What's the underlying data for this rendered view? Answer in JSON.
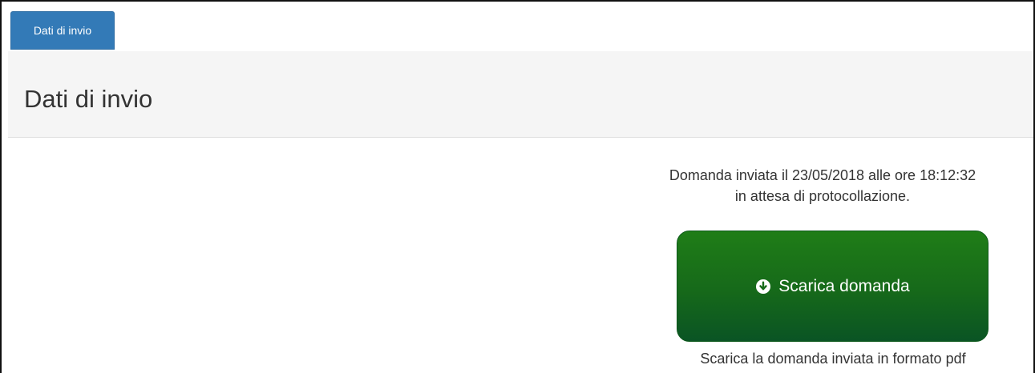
{
  "tabs": {
    "active_label": "Dati di invio"
  },
  "panel": {
    "title": "Dati di invio",
    "status": {
      "line1": "Domanda inviata il 23/05/2018 alle ore 18:12:32",
      "line2": "in attesa di protocollazione."
    },
    "download": {
      "icon": "circle-arrow-down-icon",
      "label": "Scarica domanda",
      "caption": "Scarica la domanda inviata in formato pdf"
    }
  },
  "colors": {
    "tab_active": "#337ab7",
    "button_top": "#1f7d17",
    "button_bottom": "#0a5424",
    "heading_bg": "#f5f5f5"
  }
}
